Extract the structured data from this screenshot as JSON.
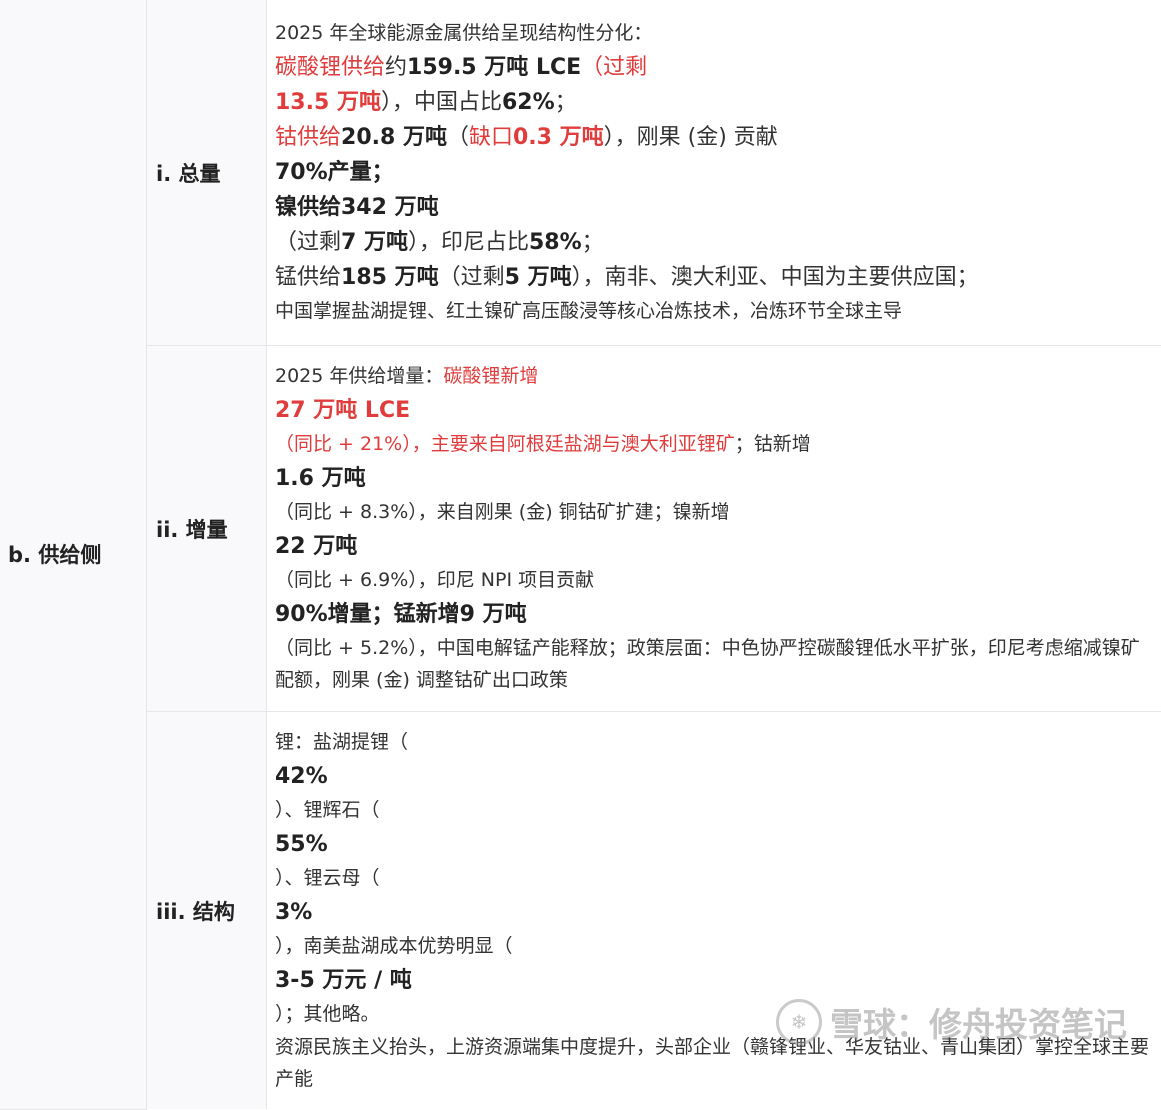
{
  "rows": [
    {
      "category": "b. 供给侧",
      "sub": "i. 总量",
      "lines": [
        [
          {
            "t": "2025 年全球能源金属供给呈现结构性分化：",
            "s": "n"
          }
        ],
        [
          {
            "t": "碳酸锂供给",
            "s": "r"
          },
          {
            "t": "约",
            "s": "n"
          },
          {
            "t": "159.5 万吨 LCE",
            "s": "b"
          },
          {
            "t": "（过剩",
            "s": "r"
          }
        ],
        [
          {
            "t": "13.5 万吨",
            "s": "rb"
          },
          {
            "t": "），中国占比",
            "s": "n"
          },
          {
            "t": "62%",
            "s": "b"
          },
          {
            "t": "；",
            "s": "n"
          }
        ],
        [
          {
            "t": "钴供给",
            "s": "r"
          },
          {
            "t": "20.8 万吨",
            "s": "b"
          },
          {
            "t": "（",
            "s": "n"
          },
          {
            "t": "缺口",
            "s": "r"
          },
          {
            "t": "0.3 万吨",
            "s": "rb"
          },
          {
            "t": "），刚果 (金) 贡献",
            "s": "n"
          }
        ],
        [
          {
            "t": "70%产量；",
            "s": "b"
          }
        ],
        [
          {
            "t": "镍供给342 万吨",
            "s": "b"
          }
        ],
        [
          {
            "t": "（过剩",
            "s": "n"
          },
          {
            "t": "7 万吨",
            "s": "b"
          },
          {
            "t": "），印尼占比",
            "s": "n"
          },
          {
            "t": "58%",
            "s": "b"
          },
          {
            "t": "；",
            "s": "n"
          }
        ],
        [
          {
            "t": "锰供给",
            "s": "n"
          },
          {
            "t": "185 万吨",
            "s": "b"
          },
          {
            "t": "（过剩",
            "s": "n"
          },
          {
            "t": "5 万吨",
            "s": "b"
          },
          {
            "t": "），南非、澳大利亚、中国为主要供应国；",
            "s": "n"
          }
        ],
        [
          {
            "t": "中国掌握盐湖提锂、红土镍矿高压酸浸等核心冶炼技术，冶炼环节全球主导",
            "s": "n"
          }
        ]
      ]
    },
    {
      "category": "",
      "sub": "ii. 增量",
      "lines": [
        [
          {
            "t": "2025 年供给增量：",
            "s": "n"
          },
          {
            "t": "碳酸锂新增",
            "s": "r"
          }
        ],
        [
          {
            "t": "27 万吨 LCE",
            "s": "rb"
          }
        ],
        [
          {
            "t": "（同比 + 21%），主要来自阿根廷盐湖与澳大利亚锂矿",
            "s": "r"
          },
          {
            "t": "；钴新增",
            "s": "n"
          }
        ],
        [
          {
            "t": "1.6 万吨",
            "s": "b"
          }
        ],
        [
          {
            "t": "（同比 + 8.3%），来自刚果 (金) 铜钴矿扩建；镍新增",
            "s": "n"
          }
        ],
        [
          {
            "t": "22 万吨",
            "s": "b"
          }
        ],
        [
          {
            "t": "（同比 + 6.9%），印尼 NPI 项目贡献",
            "s": "n"
          }
        ],
        [
          {
            "t": "90%增量；锰新增9 万吨",
            "s": "b"
          }
        ],
        [
          {
            "t": "（同比 + 5.2%），中国电解锰产能释放；政策层面：中色协严控碳酸锂低水平扩张，印尼考虑缩减镍矿配额，刚果 (金) 调整钴矿出口政策",
            "s": "n",
            "wrap": true
          }
        ]
      ]
    },
    {
      "category": "",
      "sub": "iii. 结构",
      "lines": [
        [
          {
            "t": "锂：盐湖提锂（",
            "s": "n"
          }
        ],
        [
          {
            "t": "42%",
            "s": "b"
          }
        ],
        [
          {
            "t": "）、锂辉石（",
            "s": "n"
          }
        ],
        [
          {
            "t": "55%",
            "s": "b"
          }
        ],
        [
          {
            "t": "）、锂云母（",
            "s": "n"
          }
        ],
        [
          {
            "t": "3%",
            "s": "b"
          }
        ],
        [
          {
            "t": "），南美盐湖成本优势明显（",
            "s": "n"
          }
        ],
        [
          {
            "t": "3-5 万元 / 吨",
            "s": "b"
          }
        ],
        [
          {
            "t": "）；其他略。",
            "s": "n"
          }
        ],
        [
          {
            "t": "资源民族主义抬头，上游资源端集中度提升，头部企业（赣锋锂业、华友钴业、青山集团）掌控全球主要产能",
            "s": "n",
            "wrap": true
          }
        ]
      ]
    }
  ],
  "watermark": {
    "logo": "❄",
    "text": "雪球：修舟投资笔记"
  }
}
